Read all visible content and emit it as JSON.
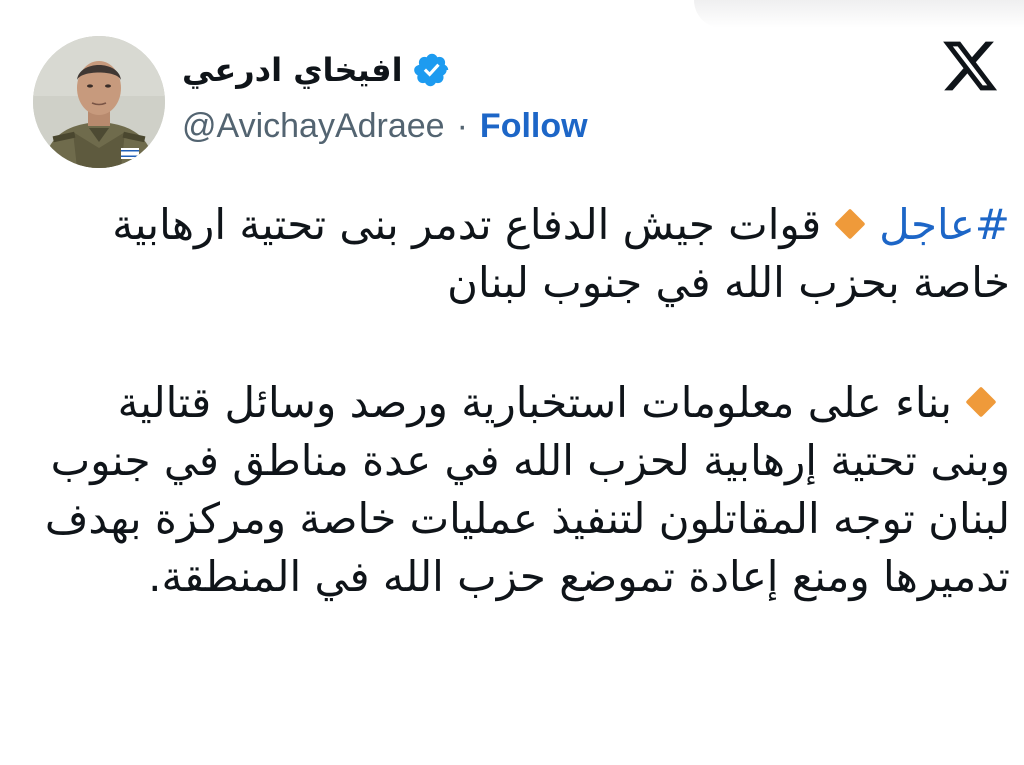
{
  "author": {
    "display_name": "افيخاي ادرعي",
    "handle": "@AvichayAdraee",
    "separator": "·",
    "follow_label": "Follow",
    "verified_icon": "verified-badge-icon",
    "verified_color": "#1d9bf0"
  },
  "header": {
    "platform_icon": "x-logo-icon"
  },
  "tweet": {
    "hashtag": "#عاجل",
    "headline": "قوات جيش الدفاع تدمر  بنى تحتية ارهابية خاصة بحزب الله في جنوب لبنان",
    "body": "بناء على معلومات استخبارية ورصد وسائل قتالية وبنى تحتية إرهابية لحزب الله في عدة مناطق في جنوب لبنان توجه المقاتلون لتنفيذ عمليات خاصة ومركزة بهدف تدميرها ومنع إعادة تموضع حزب الله في المنطقة.",
    "bullet_icon": "orange-diamond-icon",
    "bullet_color": "#ef9a3a",
    "link_color": "#1d66c7"
  }
}
